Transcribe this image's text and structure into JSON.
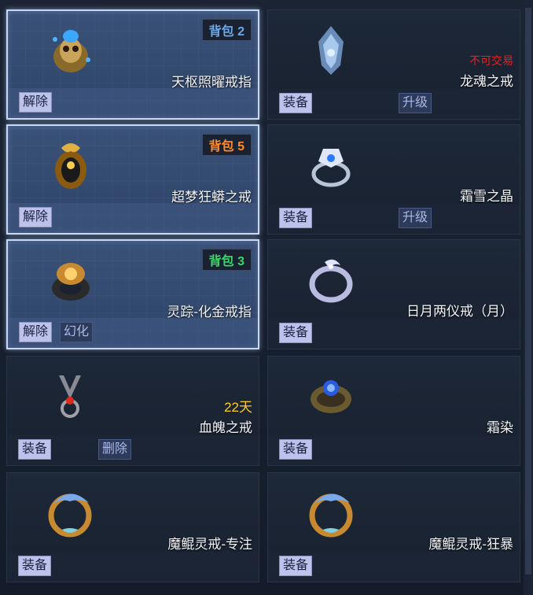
{
  "items": [
    {
      "name": "天枢照曜戒指",
      "badge": "背包 2",
      "btn1": "解除"
    },
    {
      "name": "龙魂之戒",
      "tag": "不可交易",
      "btn1": "装备",
      "btn2": "升级"
    },
    {
      "name": "超梦狂蟒之戒",
      "badge": "背包 5",
      "btn1": "解除"
    },
    {
      "name": "霜雪之晶",
      "btn1": "装备",
      "btn2": "升级"
    },
    {
      "name": "灵踪-化金戒指",
      "badge": "背包 3",
      "btn1": "解除",
      "btn2": "幻化"
    },
    {
      "name": "日月两仪戒（月）",
      "btn1": "装备"
    },
    {
      "name": "血魄之戒",
      "tag": "22天",
      "btn1": "装备",
      "btn2": "删除"
    },
    {
      "name": "霜染",
      "btn1": "装备"
    },
    {
      "name": "魔鲲灵戒-专注",
      "btn1": "装备"
    },
    {
      "name": "魔鲲灵戒-狂暴",
      "btn1": "装备"
    }
  ],
  "colors": {
    "badge_blue": "#6aa8e8",
    "badge_orange": "#ff8a2a",
    "badge_green": "#3bd66b",
    "tag_red": "#e62020",
    "tag_gold": "#ffcc22"
  },
  "icons": [
    "skull-ring-icon",
    "dragon-ring-icon",
    "serpent-ring-icon",
    "crystal-ring-icon",
    "gold-ring-icon",
    "moon-ring-icon",
    "blood-ring-icon",
    "frost-ring-icon",
    "kun-ring-icon",
    "kun-ring-icon"
  ]
}
